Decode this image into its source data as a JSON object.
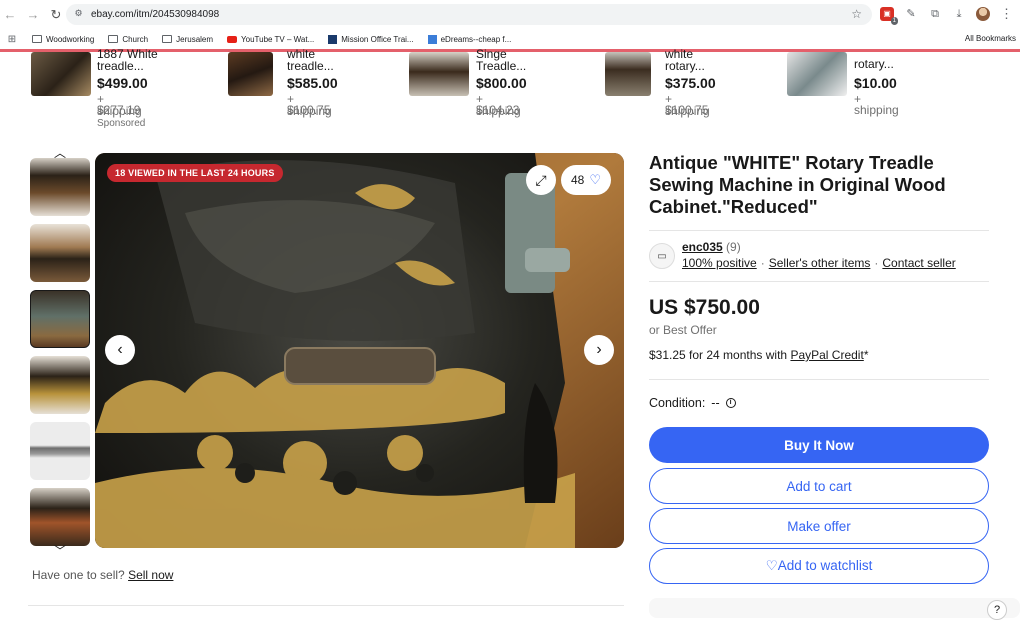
{
  "browser": {
    "url": "ebay.com/itm/204530984098",
    "bookmarks": [
      "Woodworking",
      "Church",
      "Jerusalem",
      "YouTube TV – Wat...",
      "Mission Office Trai...",
      "eDreams--cheap f..."
    ],
    "all_bookmarks": "All Bookmarks",
    "extension_badge": "1"
  },
  "carousel": [
    {
      "title": "1887 White",
      "title2": "treadle...",
      "price": "$499.00",
      "shipping": "+ $277.19",
      "shipping2": "shipping",
      "sponsored": "Sponsored"
    },
    {
      "title": "white",
      "title2": "treadle...",
      "price": "$585.00",
      "shipping": "+ $100.75",
      "shipping2": "shipping"
    },
    {
      "title": "Singe",
      "title2": "Treadle...",
      "price": "$800.00",
      "shipping": "+ $104.23",
      "shipping2": "shipping"
    },
    {
      "title": "white",
      "title2": "rotary...",
      "price": "$375.00",
      "shipping": "+ $100.75",
      "shipping2": "shipping"
    },
    {
      "title": "rotary...",
      "title2": "",
      "price": "$10.00",
      "shipping": "+ shipping",
      "shipping2": ""
    }
  ],
  "gallery": {
    "viewed_badge": "18 VIEWED IN THE LAST 24 HOURS",
    "watch_count": "48"
  },
  "sell": {
    "prompt": "Have one to sell?",
    "link": "Sell now"
  },
  "listing": {
    "title": "Antique \"WHITE\" Rotary Treadle Sewing Machine in Original Wood Cabinet.\"Reduced\"",
    "seller_name": "enc035",
    "seller_feedback": "(9)",
    "positive": "100% positive",
    "other_items": "Seller's other items",
    "contact": "Contact seller",
    "price": "US $750.00",
    "best_offer": "or Best Offer",
    "credit_prefix": "$31.25 for 24 months with",
    "credit_link": "PayPal Credit",
    "credit_suffix": "*",
    "condition_label": "Condition:",
    "condition_value": "--",
    "buy_now": "Buy It Now",
    "add_cart": "Add to cart",
    "make_offer": "Make offer",
    "watchlist": "♡Add to watchlist"
  },
  "colors": {
    "accent": "#3665f3",
    "badge": "#c6282f"
  }
}
